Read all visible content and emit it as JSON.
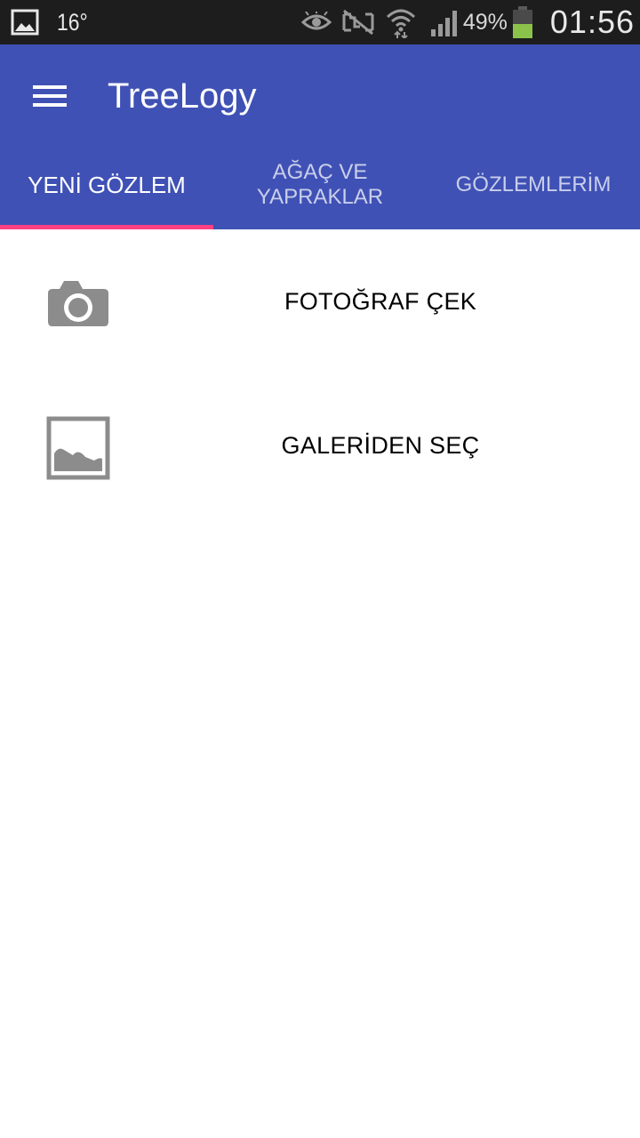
{
  "status_bar": {
    "temperature": "16°",
    "battery_percent": "49%",
    "battery_level": 0.49,
    "clock": "01:56",
    "icons": [
      "gallery-notification-icon",
      "eye-icon",
      "nfc-muted-icon",
      "wifi-icon",
      "signal-icon",
      "battery-icon"
    ]
  },
  "app_bar": {
    "title": "TreeLogy",
    "menu_icon": "hamburger-menu-icon",
    "color": "#3f51b5"
  },
  "tabs": [
    {
      "label": "YENİ GÖZLEM",
      "active": true
    },
    {
      "label": "AĞAÇ VE\nYAPRAKLAR",
      "active": false
    },
    {
      "label": "GÖZLEMLERİM",
      "active": false
    }
  ],
  "tab_indicator_color": "#ff4081",
  "options": [
    {
      "label": "FOTOĞRAF ÇEK",
      "icon": "camera-icon"
    },
    {
      "label": "GALERİDEN SEÇ",
      "icon": "image-gallery-icon"
    }
  ]
}
